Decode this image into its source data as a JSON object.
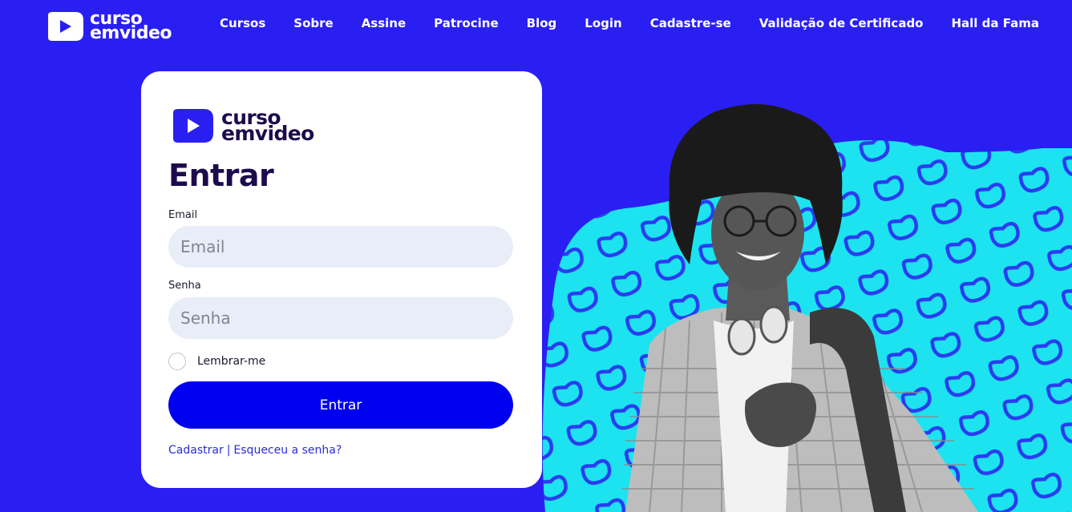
{
  "brand": {
    "line1": "curso",
    "line2": "emvideo"
  },
  "nav": [
    "Cursos",
    "Sobre",
    "Assine",
    "Patrocine",
    "Blog",
    "Login",
    "Cadastre-se",
    "Validação de Certificado",
    "Hall da Fama"
  ],
  "login": {
    "title": "Entrar",
    "email_label": "Email",
    "email_placeholder": "Email",
    "password_label": "Senha",
    "password_placeholder": "Senha",
    "remember_label": "Lembrar-me",
    "submit_label": "Entrar",
    "register_link": "Cadastrar",
    "separator": "|",
    "forgot_link": "Esqueceu a senha?"
  },
  "colors": {
    "background": "#2a1ff2",
    "brand_dark": "#1c0b4d",
    "button": "#0000f0",
    "input_bg": "#e8edf8",
    "pattern_cyan": "#1de3f0"
  },
  "icons": {
    "brand_logo": "play-icon",
    "hero": "student-with-headphones-photo"
  }
}
